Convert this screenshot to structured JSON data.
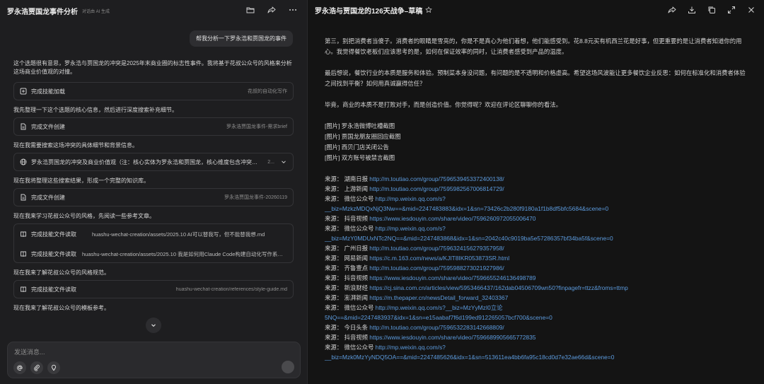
{
  "left": {
    "title": "罗永浩贾国龙事件分析",
    "subtitle": "对话由 AI 生成",
    "user_message": "帮我分析一下罗永浩和贾国龙的事件",
    "intro": "这个选题很有意思，罗永浩与贾国龙的冲突是2025年末商业圈的标志性事件。我将基于花叔公众号的风格来分析这场商业价值观的对撞。",
    "cards": {
      "c1": {
        "label": "完成技能加载",
        "right": "花叔的自动化写作"
      },
      "c2": {
        "label": "完成文件创建",
        "right": "罗永浩贾国龙事件-需求brief"
      },
      "c3": {
        "text": "罗永浩贾国龙的冲突及商业价值观（注：核心实体为罗永浩和贾国龙，核心维度包含冲突起因、发展过程、双方回应、公众舆论、行业影响）",
        "count": "2..."
      },
      "c4": {
        "label": "完成文件创建",
        "right": "罗永浩贾国龙事件-20260119"
      },
      "c5a": {
        "label": "完成技能文件读取",
        "mid": "huashu-wechat-creation/assets/2025.10 AI可以替我写，但不能替我想.md"
      },
      "c5b": {
        "label": "完成技能文件读取",
        "mid": "huashu-wechat-creation/assets/2025.10 我是如何用Claude Code构建自动化写作系统的.md"
      },
      "c6": {
        "label": "完成技能文件读取",
        "right": "huashu-wechat-creation/references/style-guide.md"
      }
    },
    "steps": {
      "s1": "我先整理一下这个选题的核心信息，然后进行深度搜索补充细节。",
      "s2": "现在我需要搜索这场冲突的具体细节和背景信息。",
      "s3": "现在我将整理这些搜索结果，形成一个完整的知识库。",
      "s4": "现在我来学习花叔公众号的风格，先阅读一些参考文章。",
      "s5": "现在我来了解花叔公众号的风格规范。",
      "s6": "现在我来了解花叔公众号的模板参考。"
    },
    "composer_placeholder": "发送消息..."
  },
  "right": {
    "title": "罗永浩与贾国龙的126天战争–草稿",
    "paragraphs": [
      "第三，别把消费者当傻子。消费者的眼睛是雪亮的，你是不是真心为他们着想，他们能感受到。花8.8元买有机西兰花是好事，但更重要的是让消费者知道你的用心。我觉得餐饮老板们应该思考的是，如何在保证效率的同时，让消费者感受到产品的温度。",
      "最后想说，餐饮行业的本质是服务和体验。预制菜本身没问题，有问题的是不透明和价格虚高。希望这场风波能让更多餐饮企业反思：如何在标准化和消费者体验之间找到平衡？如何用真诚赢得信任？",
      "毕竟，商业的本质不是打败对手，而是创造价值。你觉得呢？欢迎在评论区聊聊你的看法。"
    ],
    "images": [
      "[图片] 罗永浩微博吐槽截图",
      "[图片] 贾国龙朋友圈回应截图",
      "[图片] 西贝门店关闭公告",
      "[图片] 双方账号被禁言截图"
    ],
    "sources": [
      {
        "label": "来源：  湖南日报 ",
        "url": "http://m.toutiao.com/group/7596539453372400138/"
      },
      {
        "label": "来源：  上游新闻 ",
        "url": "http://m.toutiao.com/group/7595982567006814729/"
      },
      {
        "label": "来源：  微信公众号 ",
        "url": "http://mp.weixin.qq.com/s?"
      },
      {
        "label": "",
        "url": "__biz=MzkzMDQxNjQ3Nw==&mid=2247483883&idx=1&sn=73426c2b280f9180a1f1b8df5bfc5684&scene=0"
      },
      {
        "label": "来源：  抖音视频 ",
        "url": "https://www.iesdouyin.com/share/video/7596260972055006470"
      },
      {
        "label": "来源：  微信公众号 ",
        "url": "http://mp.weixin.qq.com/s?"
      },
      {
        "label": "",
        "url": "__biz=MzY0MDUxNTc2NQ==&mid=2247483868&idx=1&sn=2042c40c9019ba5e57286357bf34ba5f&scene=0"
      },
      {
        "label": "来源：  广州日报 ",
        "url": "http://m.toutiao.com/group/7596324156279357958/"
      },
      {
        "label": "来源：  网易新闻 ",
        "url": "https://c.m.163.com/news/a/KJIT8IKR053873SR.html"
      },
      {
        "label": "来源：  齐鲁壹点 ",
        "url": "http://m.toutiao.com/group/7595988273021927986/"
      },
      {
        "label": "来源：  抖音视频 ",
        "url": "https://www.iesdouyin.com/share/video/7596655246136498789"
      },
      {
        "label": "来源：  新浪财经 ",
        "url": "https://cj.sina.com.cn/articles/view/5953466437/162dab04506709wn50?finpagefr=ttzz&froms=ttmp"
      },
      {
        "label": "来源：  澎湃新闻 ",
        "url": "https://m.thepaper.cn/newsDetail_forward_32403367"
      },
      {
        "label": "来源：  微信公众号 ",
        "url": "http://mp.weixin.qq.com/s?__biz=MzYyMzI0立论"
      },
      {
        "label": "",
        "url": "5NQ==&mid=2247483937&idx=1&sn=e15aabaf7f6d199ed912265057bcf700&scene=0"
      },
      {
        "label": "来源：  今日头条 ",
        "url": "http://m.toutiao.com/group/7596532283142668809/"
      },
      {
        "label": "来源：  抖音视频 ",
        "url": "https://www.iesdouyin.com/share/video/7596689905665772835"
      },
      {
        "label": "来源：  微信公众号 ",
        "url": "http://mp.weixin.qq.com/s?"
      },
      {
        "label": "",
        "url": "__biz=Mzk0MzYyNDQ5OA==&mid=2247485626&idx=1&sn=513611ea4bb6fa95c18cd0d7e32ae66d&scene=0"
      }
    ]
  }
}
